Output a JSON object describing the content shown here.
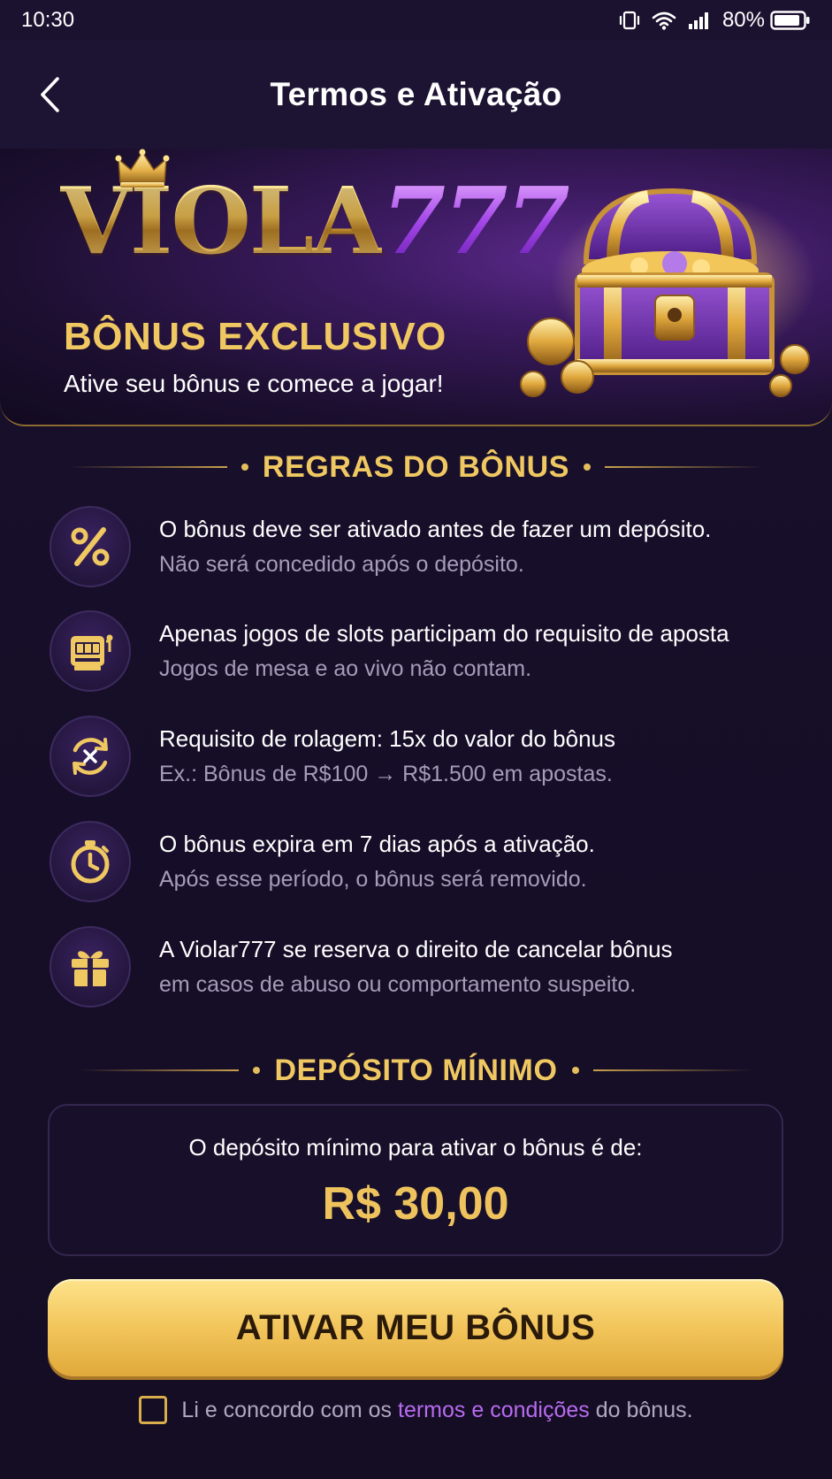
{
  "status_bar": {
    "time": "10:30",
    "battery": "80%",
    "icons": [
      "vibrate-icon",
      "wifi-icon",
      "signal-icon",
      "battery-icon"
    ]
  },
  "header": {
    "title": "Termos e Ativação",
    "back_icon": "chevron-left-icon"
  },
  "banner": {
    "logo_gold": "VIOLA",
    "logo_purple": "777",
    "subtitle": "BÔNUS EXCLUSIVO",
    "tagline": "Ative seu bônus e comece a jogar!"
  },
  "rules_section": {
    "title": "REGRAS DO BÔNUS",
    "items": [
      {
        "icon": "percent-icon",
        "main": "O bônus deve ser ativado antes de fazer um depósito.",
        "sub": "Não será concedido após o depósito."
      },
      {
        "icon": "slot-machine-icon",
        "main": "Apenas jogos de slots participam do requisito de aposta",
        "sub": "Jogos de mesa e ao vivo não contam."
      },
      {
        "icon": "rollover-icon",
        "main": "Requisito de rolagem: 15x do valor do bônus",
        "sub": "Ex.: Bônus de R$100 → R$1.500 em apostas."
      },
      {
        "icon": "stopwatch-icon",
        "main": "O bônus expira em 7 dias após a ativação.",
        "sub": "Após esse período, o bônus será removido."
      },
      {
        "icon": "gift-icon",
        "main": "A Violar777 se reserva o direito de cancelar bônus",
        "sub": "em casos de abuso ou comportamento suspeito."
      }
    ]
  },
  "deposit_section": {
    "title": "DEPÓSITO MÍNIMO",
    "label": "O depósito mínimo para ativar o bônus é de:",
    "value": "R$ 30,00"
  },
  "cta": {
    "label": "ATIVAR MEU BÔNUS"
  },
  "agreement": {
    "prefix": "Li e concordo com os",
    "link": "termos e condições",
    "suffix": "do bônus."
  },
  "colors": {
    "gold": "#f0c862",
    "purple_link": "#b86bf0",
    "background": "#170f29"
  }
}
